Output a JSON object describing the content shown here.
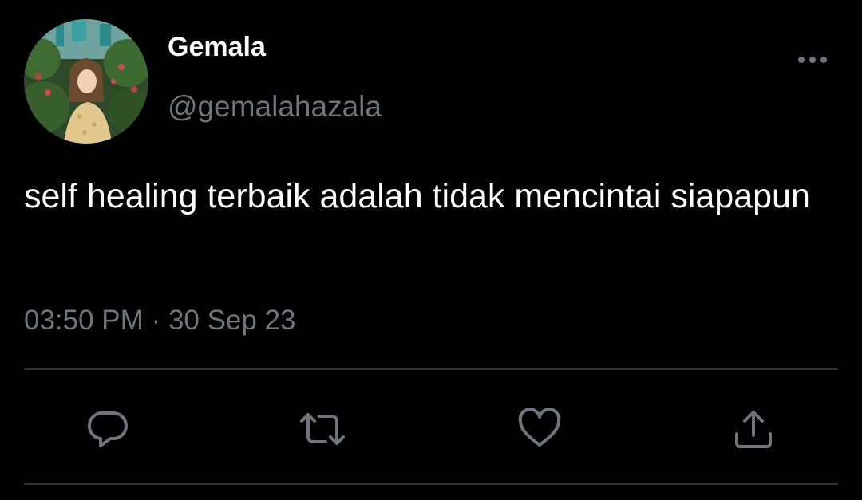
{
  "user": {
    "display_name": "Gemala",
    "handle": "@gemalahazala"
  },
  "tweet": {
    "text": "self healing terbaik adalah tidak mencintai siapapun",
    "time": "03:50 PM",
    "separator": "·",
    "date": "30 Sep 23"
  },
  "icons": {
    "more": "more-horizontal-icon",
    "reply": "reply-icon",
    "retweet": "retweet-icon",
    "like": "heart-icon",
    "share": "share-icon"
  },
  "colors": {
    "background": "#000000",
    "primary_text": "#ffffff",
    "secondary_text": "#6e767d",
    "divider": "#2f3336"
  }
}
